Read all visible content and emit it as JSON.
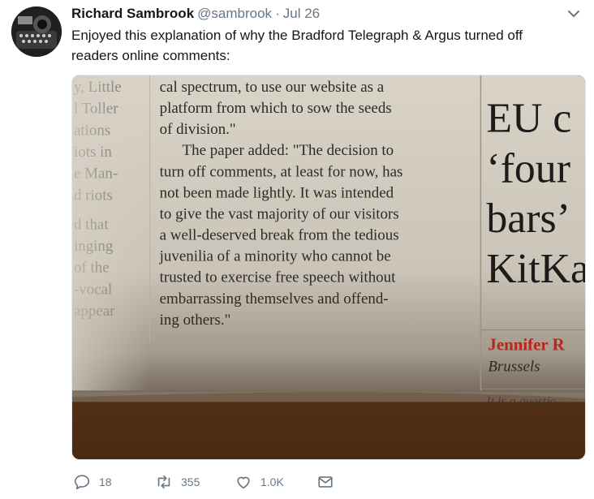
{
  "tweet": {
    "author_name": "Richard Sambrook",
    "handle": "@sambrook",
    "separator": "·",
    "date": "Jul 26",
    "text": "Enjoyed this explanation of why the Bradford Telegraph & Argus turned off readers online comments:"
  },
  "icons": {
    "menu": "chevron-down-icon",
    "reply": "reply-icon",
    "retweet": "retweet-icon",
    "like": "heart-icon",
    "dm": "mail-icon"
  },
  "actions": {
    "reply_count": "18",
    "retweet_count": "355",
    "like_count": "1.0K"
  },
  "newspaper": {
    "left_fragments": [
      "y, Little",
      "l Toller",
      "ations",
      "iots in",
      "e Man-",
      "d riots",
      "d that",
      "inging",
      "of the",
      "-vocal",
      "appear"
    ],
    "main_lines": [
      "cal spectrum, to use our website as a",
      "platform from which to sow the seeds",
      "of division.\"",
      "The paper added: \"The decision to",
      "turn off comments, at least for now, has",
      "not been made lightly. It was intended",
      "to give the vast majority of our visitors",
      "a well-deserved break from the tedious",
      "juvenilia of a minority who cannot be",
      "trusted to exercise free speech without",
      "embarrassing themselves and offend-",
      "ing others.\""
    ],
    "headline_lines": [
      "EU c",
      "‘four",
      "bars’",
      "KitKa"
    ],
    "byline": "Jennifer R",
    "dateline": "Brussels",
    "teaser": "It is a questio"
  },
  "colors": {
    "text_primary": "#14171a",
    "text_secondary": "#657786",
    "headline_red": "#b5261e",
    "wood": "#5a3418"
  }
}
